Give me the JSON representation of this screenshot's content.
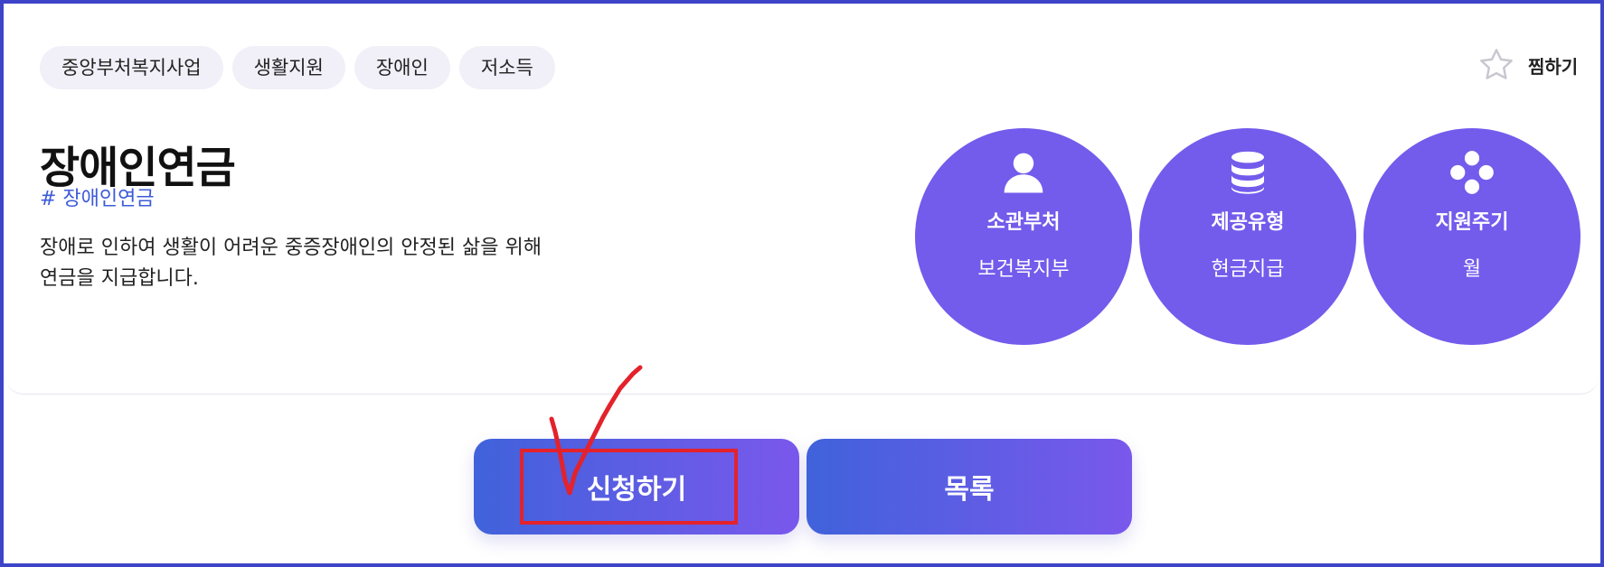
{
  "tags": [
    "중앙부처복지사업",
    "생활지원",
    "장애인",
    "저소득"
  ],
  "bookmark": {
    "label": "찜하기",
    "icon": "star-outline-icon"
  },
  "title": "장애인연금",
  "hashtag": "# 장애인연금",
  "description": "장애로 인하여 생활이 어려운 중증장애인의 안정된 삶을 위해 연금을 지급합니다.",
  "info": [
    {
      "label": "소관부처",
      "value": "보건복지부",
      "icon": "person-icon"
    },
    {
      "label": "제공유형",
      "value": "현금지급",
      "icon": "database-icon"
    },
    {
      "label": "지원주기",
      "value": "월",
      "icon": "cycle-dots-icon"
    }
  ],
  "buttons": {
    "apply": "신청하기",
    "list": "목록"
  },
  "colors": {
    "accent": "#735bec",
    "hashtag": "#3d5bd9",
    "tag_bg": "#f1f0f8",
    "annotation": "#e3222b"
  }
}
